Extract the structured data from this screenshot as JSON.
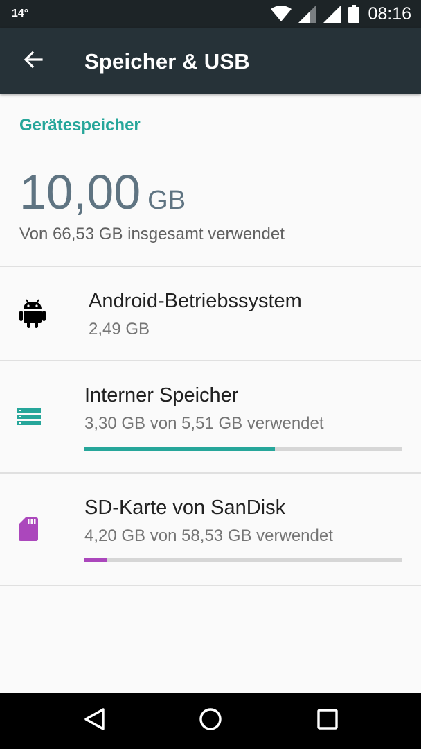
{
  "status_bar": {
    "temperature": "14°",
    "time": "08:16",
    "icons": [
      "wifi-icon",
      "signal-icon",
      "signal-icon",
      "battery-icon"
    ]
  },
  "toolbar": {
    "title": "Speicher & USB",
    "back_icon": "arrow-back-icon"
  },
  "device_storage": {
    "header": "Gerätespeicher",
    "total_value": "10,00",
    "total_unit": "GB",
    "caption": "Von 66,53 GB insgesamt verwendet"
  },
  "items": [
    {
      "icon": "android-icon",
      "title": "Android-Betriebssystem",
      "subtitle": "2,49 GB"
    },
    {
      "icon": "internal-storage-icon",
      "title": "Interner Speicher",
      "subtitle": "3,30 GB von 5,51 GB verwendet",
      "usage_fraction": 0.599,
      "color": "#26a69a"
    },
    {
      "icon": "sd-card-icon",
      "title": "SD-Karte von SanDisk",
      "subtitle": "4,20 GB von 58,53 GB verwendet",
      "usage_fraction": 0.0718,
      "color": "#ab47bc"
    }
  ],
  "nav_bar": {
    "icons": [
      "back-triangle-icon",
      "home-circle-icon",
      "recents-square-icon"
    ]
  },
  "colors": {
    "toolbar": "#263238",
    "status_bar": "#1d2427",
    "accent": "#26a69a",
    "sd_card": "#ab47bc",
    "track": "#d6d6d6"
  }
}
